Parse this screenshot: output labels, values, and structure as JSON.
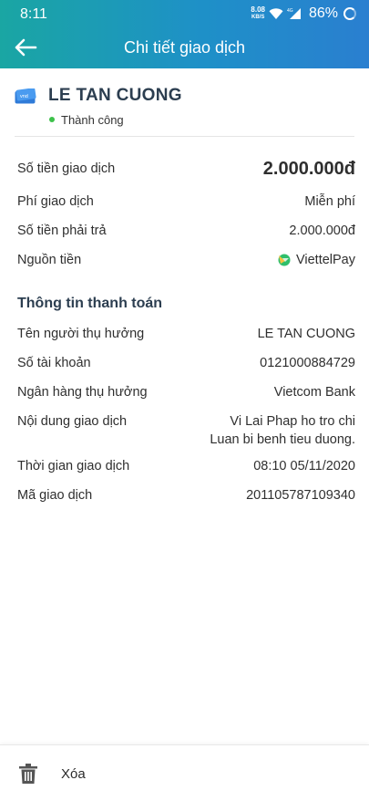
{
  "status_bar": {
    "time": "8:11",
    "net_speed_value": "8.08",
    "net_speed_unit": "KB/S",
    "battery": "86%"
  },
  "header": {
    "title": "Chi tiết giao dịch"
  },
  "account": {
    "icon_text": "vnd",
    "name": "LE TAN CUONG",
    "status": "Thành công"
  },
  "summary": [
    {
      "label": "Số tiền giao dịch",
      "value": "2.000.000đ"
    },
    {
      "label": "Phí giao dịch",
      "value": "Miễn phí"
    },
    {
      "label": "Số tiền phải trả",
      "value": "2.000.000đ"
    },
    {
      "label": "Nguồn tiền",
      "value": "ViettelPay"
    }
  ],
  "payment_info": {
    "title": "Thông tin thanh toán",
    "rows": [
      {
        "label": "Tên người thụ hưởng",
        "value": "LE TAN CUONG"
      },
      {
        "label": "Số tài khoản",
        "value": "0121000884729"
      },
      {
        "label": "Ngân hàng thụ hưởng",
        "value": "Vietcom Bank"
      },
      {
        "label": "Nội dung giao dịch",
        "value_line1": "Vi Lai Phap ho tro chi",
        "value_line2": "Luan bi benh tieu duong."
      },
      {
        "label": "Thời gian giao dịch",
        "value": "08:10 05/11/2020"
      },
      {
        "label": "Mã giao dịch",
        "value": "201105787109340"
      }
    ]
  },
  "footer": {
    "delete_label": "Xóa"
  },
  "colors": {
    "header_start": "#1aa6a3",
    "header_end": "#2a7fd0",
    "success_green": "#3cc14a",
    "viettelpay_green": "#2fbf6b"
  },
  "icons": {
    "back": "arrow-left-icon",
    "account": "vnd-card-icon",
    "source": "viettelpay-logo-icon",
    "delete": "trash-icon"
  }
}
